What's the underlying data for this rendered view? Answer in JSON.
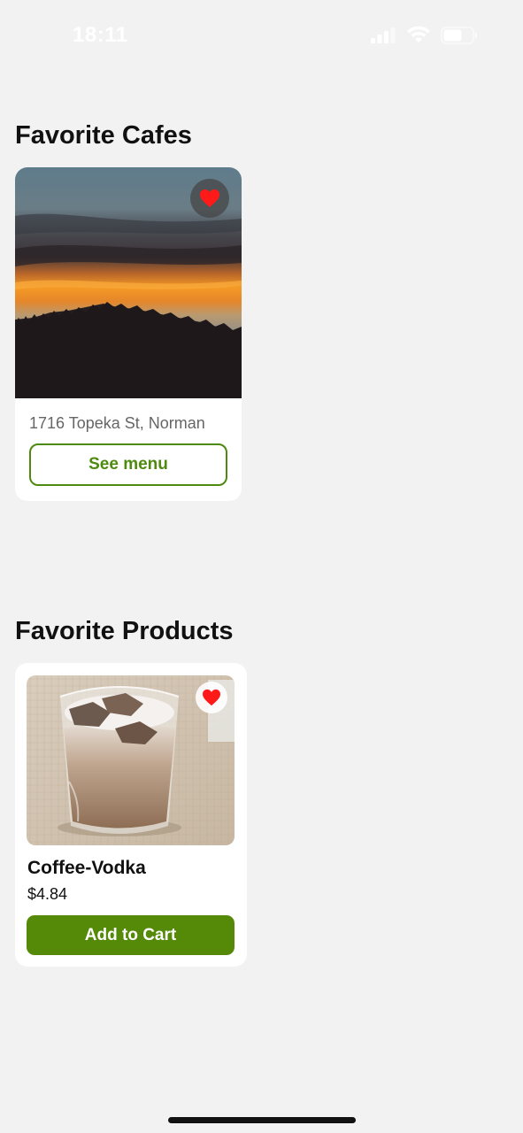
{
  "status_bar": {
    "time": "18:11",
    "signal_icon": "cellular-signal-icon",
    "wifi_icon": "wifi-icon",
    "battery_icon": "battery-icon"
  },
  "favorite_cafes": {
    "title": "Favorite Cafes",
    "cafes": [
      {
        "image": "sunset-over-hills-photo",
        "favorite_icon": "heart-icon",
        "address": "1716 Topeka St, Norman",
        "button_label": "See menu"
      }
    ]
  },
  "favorite_products": {
    "title": "Favorite Products",
    "products": [
      {
        "image": "iced-coffee-glass-photo",
        "favorite_icon": "heart-icon",
        "name": "Coffee-Vodka",
        "price": "$4.84",
        "button_label": "Add to Cart"
      }
    ]
  },
  "colors": {
    "accent_green": "#558a08",
    "outline_green": "#4d8a0f",
    "heart_red": "#ff1a1a",
    "background": "#f2f2f2"
  }
}
